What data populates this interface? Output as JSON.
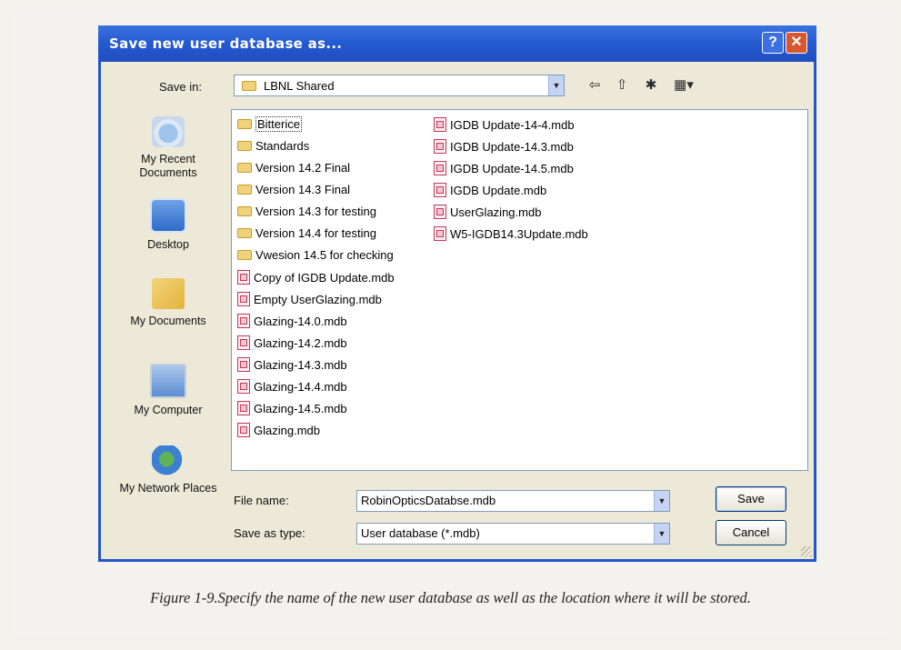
{
  "dialog": {
    "title": "Save new user database as...",
    "help_glyph": "?",
    "close_glyph": "✕"
  },
  "save_in": {
    "label": "Save in:",
    "value": "LBNL Shared"
  },
  "toolbar": {
    "back_glyph": "⇦",
    "up_glyph": "⇧",
    "new_folder_glyph": "✱",
    "views_glyph": "▦▾"
  },
  "places": [
    {
      "label": "My Recent Documents",
      "icon": "recent-documents-icon"
    },
    {
      "label": "Desktop",
      "icon": "desktop-icon"
    },
    {
      "label": "My Documents",
      "icon": "my-documents-icon"
    },
    {
      "label": "My Computer",
      "icon": "my-computer-icon"
    },
    {
      "label": "My Network Places",
      "icon": "network-places-icon"
    }
  ],
  "files": {
    "col1": [
      {
        "name": "Bitterice",
        "type": "folder"
      },
      {
        "name": "Standards",
        "type": "folder"
      },
      {
        "name": "Version 14.2 Final",
        "type": "folder"
      },
      {
        "name": "Version 14.3 Final",
        "type": "folder"
      },
      {
        "name": "Version 14.3 for testing",
        "type": "folder"
      },
      {
        "name": "Version 14.4 for testing",
        "type": "folder"
      },
      {
        "name": "Vwesion 14.5 for checking",
        "type": "folder"
      },
      {
        "name": "Copy of IGDB Update.mdb",
        "type": "mdb"
      },
      {
        "name": "Empty UserGlazing.mdb",
        "type": "mdb"
      },
      {
        "name": "Glazing-14.0.mdb",
        "type": "mdb"
      },
      {
        "name": "Glazing-14.2.mdb",
        "type": "mdb"
      },
      {
        "name": "Glazing-14.3.mdb",
        "type": "mdb"
      },
      {
        "name": "Glazing-14.4.mdb",
        "type": "mdb"
      },
      {
        "name": "Glazing-14.5.mdb",
        "type": "mdb"
      },
      {
        "name": "Glazing.mdb",
        "type": "mdb"
      }
    ],
    "col2": [
      {
        "name": "IGDB Update-14-4.mdb",
        "type": "mdb"
      },
      {
        "name": "IGDB Update-14.3.mdb",
        "type": "mdb"
      },
      {
        "name": "IGDB Update-14.5.mdb",
        "type": "mdb"
      },
      {
        "name": "IGDB Update.mdb",
        "type": "mdb"
      },
      {
        "name": "UserGlazing.mdb",
        "type": "mdb"
      },
      {
        "name": "W5-IGDB14.3Update.mdb",
        "type": "mdb"
      }
    ]
  },
  "file_name": {
    "label": "File name:",
    "value": "RobinOpticsDatabse.mdb"
  },
  "save_as_type": {
    "label": "Save as type:",
    "value": "User database (*.mdb)"
  },
  "buttons": {
    "save": "Save",
    "cancel": "Cancel"
  },
  "caption": "Figure 1-9.Specify the name of the new user database as well as the location where it will be stored."
}
